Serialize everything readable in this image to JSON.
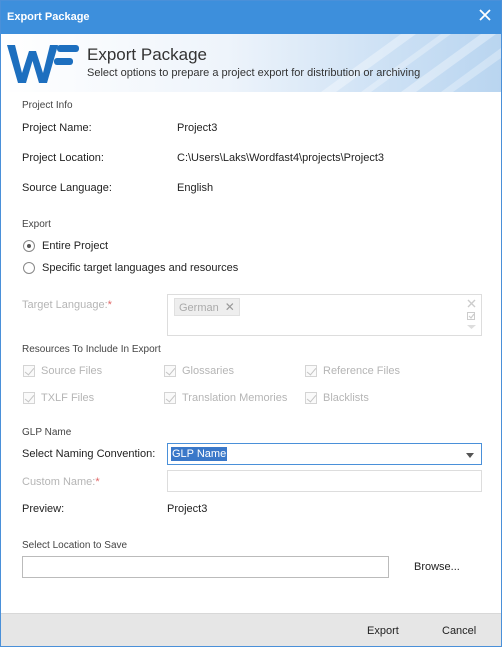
{
  "window": {
    "title": "Export Package"
  },
  "banner": {
    "title": "Export Package",
    "subtitle": "Select options to prepare a project export for distribution or archiving"
  },
  "project_info": {
    "section_label": "Project Info",
    "name_label": "Project Name:",
    "name_value": "Project3",
    "location_label": "Project Location:",
    "location_value": "C:\\Users\\Laks\\Wordfast4\\projects\\Project3",
    "source_label": "Source Language:",
    "source_value": "English"
  },
  "export": {
    "section_label": "Export",
    "options": [
      {
        "label": "Entire Project",
        "selected": true
      },
      {
        "label": "Specific target languages and resources",
        "selected": false
      }
    ],
    "target_language_label": "Target Language:",
    "required_mark": "*",
    "target_tags": [
      "German"
    ]
  },
  "resources": {
    "section_label": "Resources To Include In Export",
    "items": [
      {
        "label": "Source Files",
        "checked": true
      },
      {
        "label": "Glossaries",
        "checked": true
      },
      {
        "label": "Reference Files",
        "checked": true
      },
      {
        "label": "TXLF Files",
        "checked": true
      },
      {
        "label": "Translation Memories",
        "checked": true
      },
      {
        "label": "Blacklists",
        "checked": true
      }
    ]
  },
  "glp": {
    "section_label": "GLP Name",
    "convention_label": "Select Naming Convention:",
    "convention_value": "GLP Name",
    "custom_label": "Custom Name:",
    "required_mark": "*",
    "custom_value": "",
    "preview_label": "Preview:",
    "preview_value": "Project3"
  },
  "save": {
    "section_label": "Select Location to Save",
    "path_value": "",
    "browse_label": "Browse..."
  },
  "footer": {
    "export_label": "Export",
    "cancel_label": "Cancel"
  },
  "colors": {
    "titlebar": "#3d8fdc",
    "accent": "#3a78c9",
    "footer": "#e6e6e6"
  }
}
